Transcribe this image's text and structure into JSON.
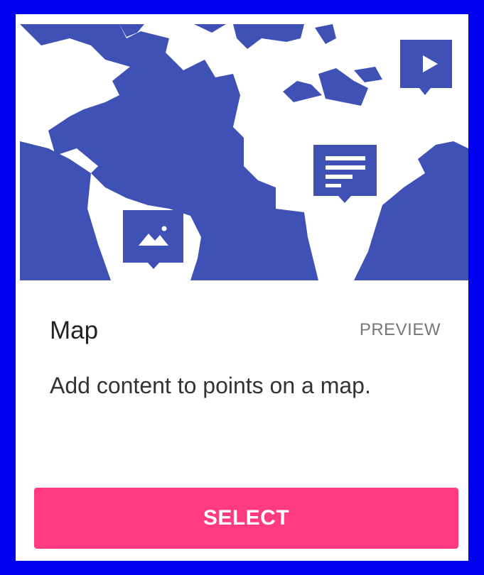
{
  "card": {
    "title": "Map",
    "preview_label": "PREVIEW",
    "description": "Add content to points on a map.",
    "select_label": "SELECT"
  },
  "illustration": {
    "land_color": "#3f51b5",
    "markers": [
      {
        "kind": "video",
        "icon": "play-icon"
      },
      {
        "kind": "text",
        "icon": "text-lines-icon"
      },
      {
        "kind": "image",
        "icon": "image-icon"
      }
    ]
  },
  "colors": {
    "frame_border": "#0000f0",
    "accent_button": "#ff3a80",
    "map_blue": "#3f51b5"
  }
}
